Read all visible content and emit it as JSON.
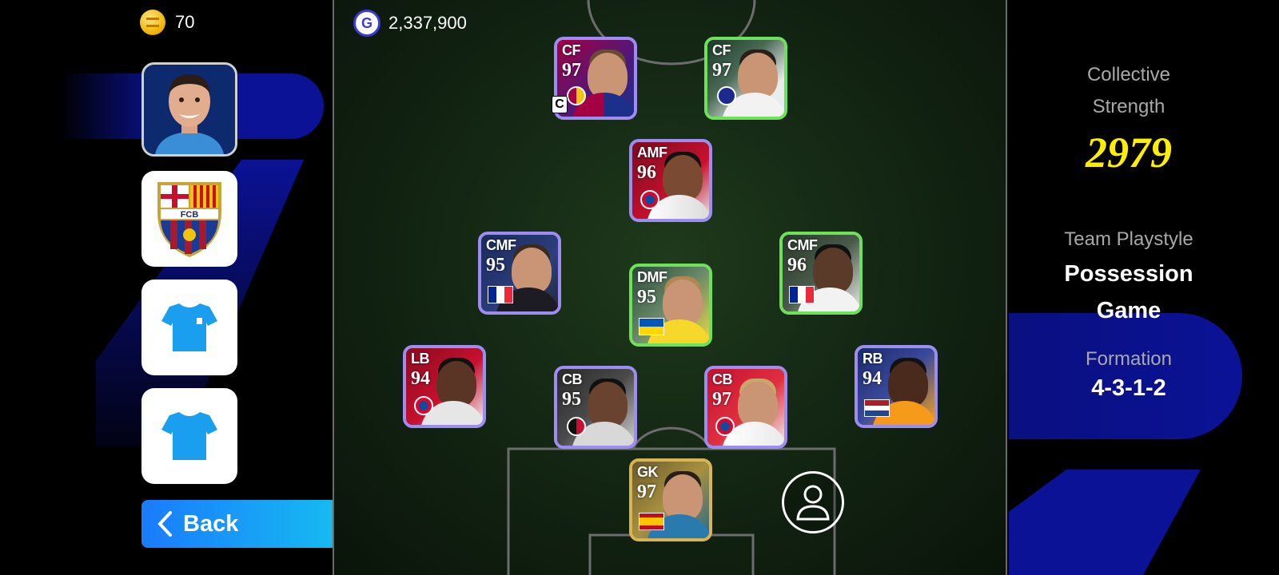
{
  "currency": {
    "coins": "70",
    "gp": "2,337,900",
    "gp_icon_letter": "G",
    "coin_icon": "coin-icon"
  },
  "sidebar": {
    "manager_icon": "manager-portrait",
    "emblem_text": "FCB",
    "home_kit_icon": "jersey-icon",
    "away_kit_icon": "jersey-icon",
    "back_label": "Back"
  },
  "squad": {
    "captain_label": "C",
    "players": [
      {
        "position": "CF",
        "rating": "97",
        "badge": "club-barcelona",
        "captain": true
      },
      {
        "position": "CF",
        "rating": "97",
        "badge": "club-inter"
      },
      {
        "position": "AMF",
        "rating": "96",
        "badge": "club-bayern"
      },
      {
        "position": "CMF",
        "rating": "95",
        "badge": "flag-france"
      },
      {
        "position": "DMF",
        "rating": "95",
        "badge": "flag-ukraine"
      },
      {
        "position": "CMF",
        "rating": "96",
        "badge": "flag-france"
      },
      {
        "position": "LB",
        "rating": "94",
        "badge": "club-bayern"
      },
      {
        "position": "CB",
        "rating": "95",
        "badge": "club-milan"
      },
      {
        "position": "CB",
        "rating": "97",
        "badge": "club-bayern"
      },
      {
        "position": "RB",
        "rating": "94",
        "badge": "flag-netherlands"
      },
      {
        "position": "GK",
        "rating": "97",
        "badge": "flag-spain"
      }
    ]
  },
  "team_info": {
    "collective_strength_label": "Collective\nStrength",
    "collective_strength_value": "2979",
    "playstyle_label": "Team Playstyle",
    "playstyle_value": "Possession\nGame",
    "formation_label": "Formation",
    "formation_value": "4-3-1-2"
  },
  "colors": {
    "accent_blue": "#1a7bff",
    "strength_yellow": "#ffee00",
    "deco_navy": "#0b1296"
  }
}
